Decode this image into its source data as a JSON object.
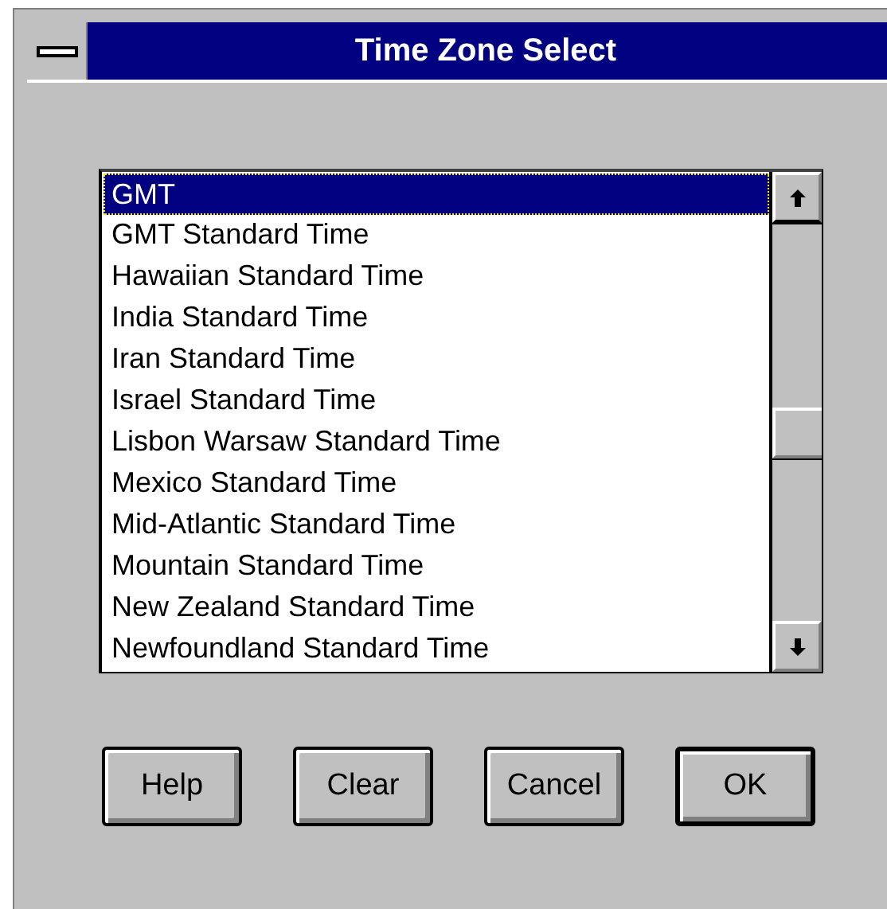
{
  "window": {
    "title": "Time Zone Select"
  },
  "time_zones": [
    {
      "label": "GMT",
      "selected": true
    },
    {
      "label": "GMT Standard Time",
      "selected": false
    },
    {
      "label": "Hawaiian Standard Time",
      "selected": false
    },
    {
      "label": "India Standard Time",
      "selected": false
    },
    {
      "label": "Iran Standard Time",
      "selected": false
    },
    {
      "label": "Israel Standard Time",
      "selected": false
    },
    {
      "label": "Lisbon Warsaw Standard Time",
      "selected": false
    },
    {
      "label": "Mexico Standard Time",
      "selected": false
    },
    {
      "label": "Mid-Atlantic Standard Time",
      "selected": false
    },
    {
      "label": "Mountain Standard Time",
      "selected": false
    },
    {
      "label": "New Zealand Standard Time",
      "selected": false
    },
    {
      "label": "Newfoundland Standard Time",
      "selected": false
    }
  ],
  "buttons": [
    {
      "label": "Help",
      "default": false
    },
    {
      "label": "Clear",
      "default": false
    },
    {
      "label": "Cancel",
      "default": false
    },
    {
      "label": "OK",
      "default": true
    }
  ]
}
